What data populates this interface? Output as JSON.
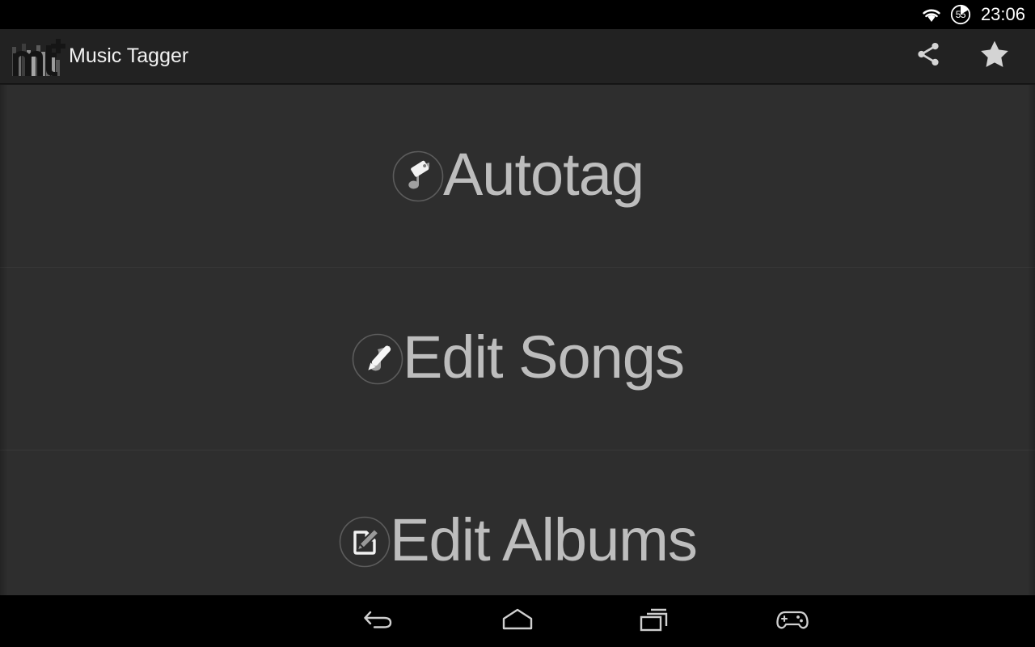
{
  "status_bar": {
    "wifi_icon": "wifi-icon",
    "battery_icon": "battery-circle-icon",
    "battery_level": "55",
    "clock": "23:06"
  },
  "action_bar": {
    "logo_icon": "music-tagger-logo-icon",
    "title": "Music Tagger",
    "actions": [
      {
        "name": "share-icon",
        "label": "Share"
      },
      {
        "name": "star-icon",
        "label": "Favorite"
      }
    ]
  },
  "menu": {
    "items": [
      {
        "label": "Autotag",
        "icon": "music-note-tag-icon"
      },
      {
        "label": "Edit Songs",
        "icon": "music-note-pen-icon"
      },
      {
        "label": "Edit Albums",
        "icon": "document-pencil-icon"
      }
    ]
  },
  "nav_bar": {
    "buttons": [
      {
        "name": "back-icon",
        "label": "Back"
      },
      {
        "name": "home-icon",
        "label": "Home"
      },
      {
        "name": "recents-icon",
        "label": "Recents"
      },
      {
        "name": "gamepad-icon",
        "label": "Game Tools"
      }
    ]
  },
  "colors": {
    "background": "#2e2e2e",
    "action_bar": "#222222",
    "status_bar": "#000000",
    "text_primary": "#f2f2f2",
    "text_item": "#bdbdbd",
    "divider": "#383838"
  }
}
